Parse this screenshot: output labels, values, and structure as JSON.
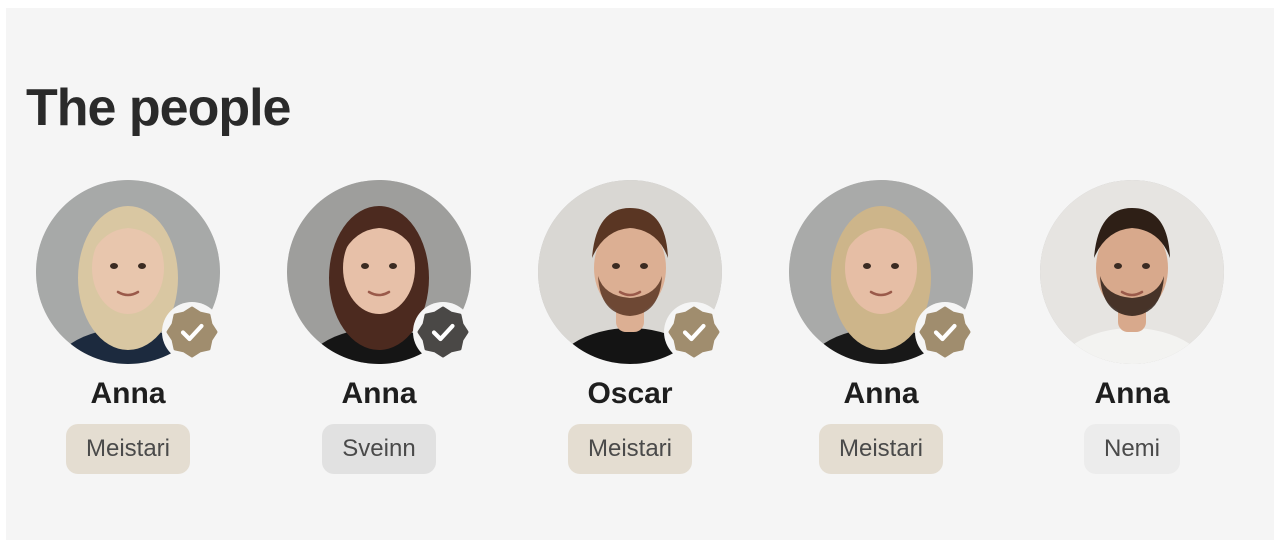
{
  "section": {
    "title": "The people"
  },
  "people": [
    {
      "name": "Anna",
      "tag": "Meistari",
      "verified": true,
      "badge_color": "#a08d6e",
      "tag_bg": "#e4ddd1",
      "hair": "#d9c7a2",
      "skin": "#e8c6ad",
      "bg": "#a7a9a8",
      "shirt": "#1c2a3e"
    },
    {
      "name": "Anna",
      "tag": "Sveinn",
      "verified": true,
      "badge_color": "#4a4846",
      "tag_bg": "#e1e1e1",
      "hair": "#4c2a1f",
      "skin": "#e7c0a8",
      "bg": "#9e9e9c",
      "shirt": "#151515"
    },
    {
      "name": "Oscar",
      "tag": "Meistari",
      "verified": true,
      "badge_color": "#a08d6e",
      "tag_bg": "#e4ddd1",
      "hair": "#5a3623",
      "skin": "#dcaf93",
      "bg": "#d9d7d3",
      "shirt": "#141414"
    },
    {
      "name": "Anna",
      "tag": "Meistari",
      "verified": true,
      "badge_color": "#a08d6e",
      "tag_bg": "#e4ddd1",
      "hair": "#cdb58a",
      "skin": "#e6bea5",
      "bg": "#a9aaa9",
      "shirt": "#181818"
    },
    {
      "name": "Anna",
      "tag": "Nemi",
      "verified": false,
      "badge_color": "",
      "tag_bg": "#ececec",
      "hair": "#2e1f16",
      "skin": "#d8a98c",
      "bg": "#e6e4e1",
      "shirt": "#f3f3f1"
    }
  ]
}
